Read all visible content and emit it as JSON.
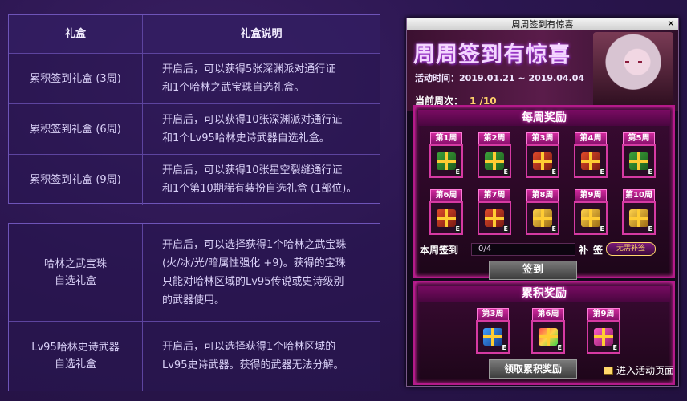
{
  "table1": {
    "header": {
      "col1": "礼盒",
      "col2": "礼盒说明"
    },
    "rows": [
      {
        "name": "累积签到礼盒 (3周)",
        "desc": [
          "开启后，可以获得5张深渊派对通行证",
          "和1个哈林之武宝珠自选礼盒。"
        ]
      },
      {
        "name": "累积签到礼盒 (6周)",
        "desc": [
          "开启后，可以获得10张深渊派对通行证",
          "和1个Lv95哈林史诗武器自选礼盒。"
        ]
      },
      {
        "name": "累积签到礼盒 (9周)",
        "desc": [
          "开启后，可以获得10张星空裂缝通行证",
          "和1个第10期稀有装扮自选礼盒 (1部位)。"
        ]
      }
    ]
  },
  "table2": {
    "rows": [
      {
        "name": [
          "哈林之武宝珠",
          "自选礼盒"
        ],
        "desc": [
          "开启后，可以选择获得1个哈林之武宝珠",
          "(火/冰/光/暗属性强化 +9)。获得的宝珠",
          "只能对哈林区域的Lv95传说或史诗级别",
          "的武器使用。"
        ]
      },
      {
        "name": [
          "Lv95哈林史诗武器",
          "自选礼盒"
        ],
        "desc": [
          "开启后，可以选择获得1个哈林区域的",
          "Lv95史诗武器。获得的武器无法分解。"
        ]
      }
    ]
  },
  "window": {
    "title": "周周签到有惊喜",
    "close_label": "✕",
    "banner_title": "周周签到有惊喜",
    "date_label": "活动时间：2019.01.21 ~ 2019.04.04",
    "current_week_label": "当前周次：",
    "current_week_value": "1 /10",
    "weekly_title": "每周奖励",
    "weeks": [
      "第1周",
      "第2周",
      "第3周",
      "第4周",
      "第5周",
      "第6周",
      "第7周",
      "第8周",
      "第9周",
      "第10周"
    ],
    "week_gift_colors": [
      "green",
      "green",
      "red",
      "red",
      "green",
      "red",
      "red",
      "gold",
      "gold",
      "gold"
    ],
    "sign_label": "本周签到",
    "sign_progress": "0/4",
    "makeup_label": "补签",
    "makeup_button": "无需补签",
    "sign_button": "签到",
    "accum_title": "累积奖励",
    "accum_weeks": [
      "第3周",
      "第6周",
      "第9周"
    ],
    "accum_gift_colors": [
      "blue",
      "rainbow",
      "pink"
    ],
    "claim_button": "领取累积奖励",
    "enter_link": "进入活动页面"
  }
}
